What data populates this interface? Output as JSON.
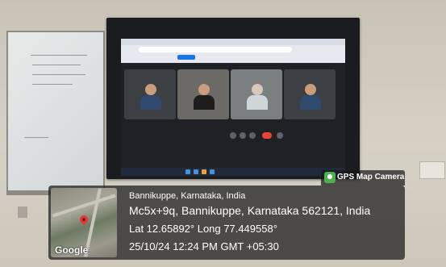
{
  "overlay": {
    "badge_title": "GPS Map Camera",
    "map_brand": "Google",
    "place": "Bannikuppe, Karnataka, India",
    "address": "Mc5x+9q, Bannikuppe, Karnataka 562121, India",
    "coordinates": "Lat 12.65892° Long 77.449558°",
    "timestamp": "25/10/24 12:24 PM GMT +05:30"
  },
  "icons": {
    "badge_icon": "camera-pin-icon",
    "map_pin": "map-pin-icon"
  },
  "colors": {
    "overlay_bg": "#191919",
    "pin": "#e53935",
    "hangup": "#ea4335",
    "badge_icon": "#4caf50"
  }
}
